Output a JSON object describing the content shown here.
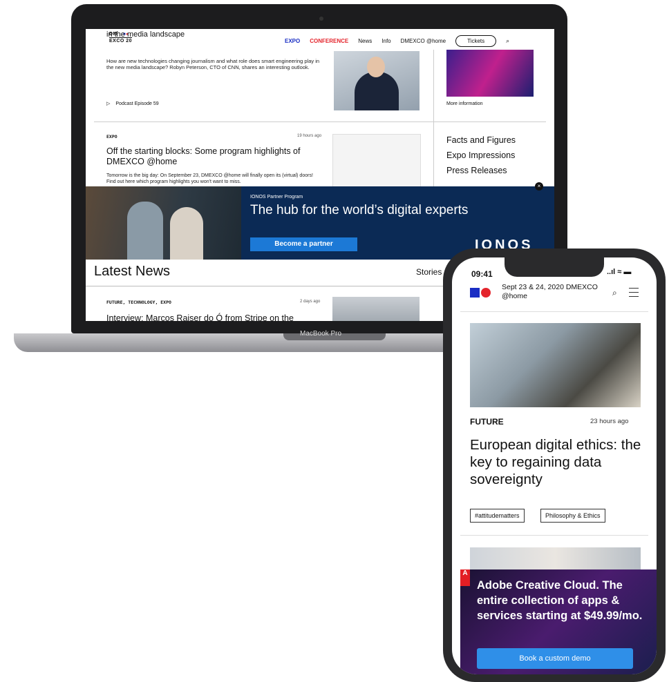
{
  "laptop": {
    "label": "MacBook Pro",
    "nav": {
      "logo_line1": "DM",
      "logo_line2": "EXCO 20",
      "links": [
        "EXPO",
        "CONFERENCE",
        "News",
        "Info",
        "DMEXCO @home"
      ],
      "tickets": "Tickets"
    },
    "article1": {
      "title_cut": "in the media landscape",
      "text": "How are new technologies changing journalism and what role does smart engineering play in the new media landscape? Robyn Peterson, CTO of CNN, shares an interesting outlook.",
      "podcast": "Podcast Episode 59"
    },
    "sidebar": {
      "more_info": "More information",
      "links": [
        "Facts and Figures",
        "Expo Impressions",
        "Press Releases"
      ]
    },
    "article2": {
      "tag": "EXPO",
      "time": "19 hours ago",
      "title": "Off the starting blocks: Some program highlights of DMEXCO @home",
      "text": "Tomorrow is the big day: On September 23, DMEXCO @home will finally open its (virtual) doors! Find out here which program highlights you won't want to miss."
    },
    "banner": {
      "small": "IONOS Partner Program",
      "title": "The hub for the world’s digital experts",
      "button": "Become a partner",
      "brand": "IONOS",
      "close": "×"
    },
    "latest_news": "Latest News",
    "stories": "Stories",
    "article3": {
      "tag": "FUTURE, TECHNOLOGY, EXPO",
      "time": "2 days ago",
      "title": "Interview: Marcos Raiser do Ó from Stripe on the"
    }
  },
  "phone": {
    "time": "09:41",
    "status": "..ıl ≈ ▬",
    "header": "Sept 23 & 24, 2020 DMEXCO @home",
    "article": {
      "tag": "FUTURE",
      "time": "23 hours ago",
      "title": "European digital ethics: the key to regaining data sovereignty",
      "chips": [
        "#attitudematters",
        "Philosophy & Ethics"
      ]
    },
    "ad": {
      "logo": "A",
      "text": "Adobe Creative Cloud. The entire collection of apps & services starting at $49.99/mo.",
      "button": "Book a custom demo"
    }
  },
  "colors": {
    "brand_blue": "#1a2ec4",
    "brand_red": "#e4242c",
    "banner_bg": "#0b2a55",
    "button_blue": "#1c79d6"
  }
}
